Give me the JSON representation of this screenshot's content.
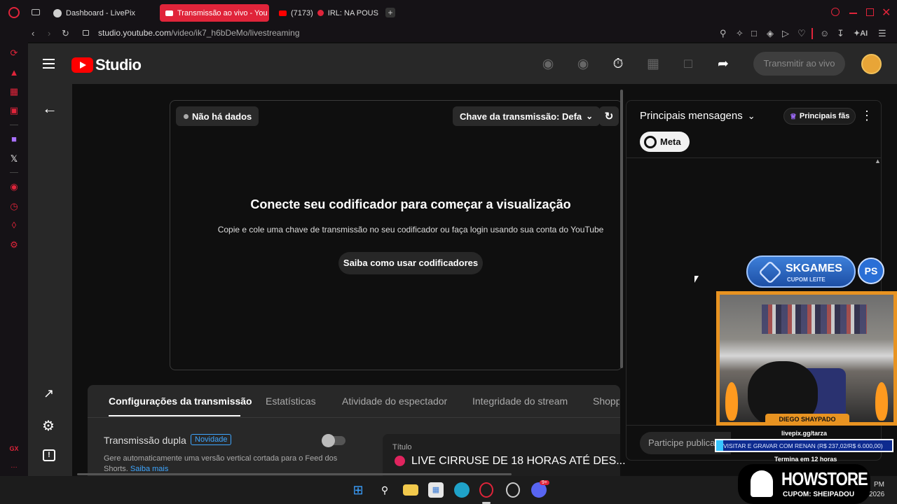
{
  "browser": {
    "tabs": [
      {
        "label": "Dashboard - LivePix",
        "favicon_color": "#cfcfcf"
      },
      {
        "label": "Transmissão ao vivo - You",
        "favicon_color": "#ff0000"
      },
      {
        "label": "(7173)",
        "favicon_color": "#ff0000"
      },
      {
        "label": "IRL: NA POUSAD",
        "favicon_color": "#e0243a"
      }
    ],
    "url_host": "studio.youtube.com",
    "url_path": "/video/ik7_h6bDeMo/livestreaming",
    "ai_label": "AI"
  },
  "studio": {
    "logo_text": "Studio",
    "go_live_label": "Transmitir ao vivo"
  },
  "preview": {
    "status_label": "Não há dados",
    "stream_key_label": "Chave da transmissão: Defa",
    "heading": "Conecte seu codificador para começar a visualização",
    "description": "Copie e cole uma chave de transmissão no seu codificador ou faça login usando sua conta do YouTube",
    "help_button": "Saiba como usar codificadores"
  },
  "settings": {
    "tabs": [
      "Configurações da transmissão",
      "Estatísticas",
      "Atividade do espectador",
      "Integridade do stream",
      "Shopp"
    ],
    "dual_stream_label": "Transmissão dupla",
    "new_badge": "Novidade",
    "dual_desc_line1": "Gere automaticamente uma versão vertical cortada para o Feed dos",
    "dual_desc_line2": "Shorts.",
    "learn_more": "Saiba mais",
    "title_label": "Título",
    "title_value": "LIVE CIRRUSE DE 18 HORAS ATÉ DES..."
  },
  "chat": {
    "mode_label": "Principais mensagens",
    "top_fans": "Principais fãs",
    "meta_chip": "Meta",
    "input_placeholder": "Participe publica"
  },
  "overlay": {
    "sponsor_name": "SKGAMES",
    "sponsor_sub": "CUPOM LEITE",
    "streamer": "DIEGO SHAYPADO",
    "livepix_link": "livepix.gg/tarza",
    "goal_text": "VISITAR E GRAVAR COM RENAN (R$ 237,02/R$ 6.000,00)",
    "goal_progress": 0.0395,
    "ends_text": "Termina em 12 horas",
    "store_name": "HOWSTORE",
    "store_coupon": "CUPOM: SHEIPADOU"
  },
  "taskbar": {
    "time_suffix": "PM",
    "year_suffix": "2026",
    "discord_badge": "9+"
  }
}
